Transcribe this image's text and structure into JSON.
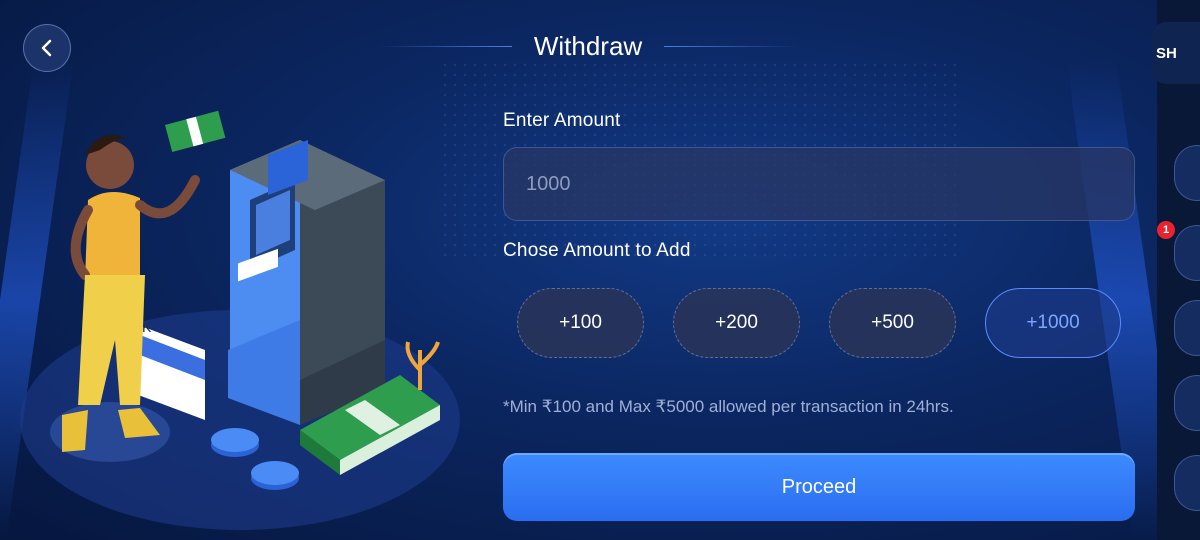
{
  "header": {
    "title": "Withdraw",
    "back_icon": "chevron-left-icon"
  },
  "form": {
    "amount_label": "Enter Amount",
    "amount_value": "1000",
    "choose_label": "Chose Amount to Add",
    "chips": [
      {
        "label": "+100",
        "selected": false
      },
      {
        "label": "+200",
        "selected": false
      },
      {
        "label": "+500",
        "selected": false
      },
      {
        "label": "+1000",
        "selected": true
      }
    ],
    "note": "*Min ₹100 and Max ₹5000 allowed per transaction in 24hrs.",
    "proceed_label": "Proceed"
  },
  "side_panel": {
    "tab_label": "SH",
    "notification_count": "1"
  },
  "illustration": {
    "card_text": "K"
  },
  "colors": {
    "accent": "#2a6df0",
    "selected_chip_text": "#7ea6ff",
    "badge": "#e8232e"
  }
}
